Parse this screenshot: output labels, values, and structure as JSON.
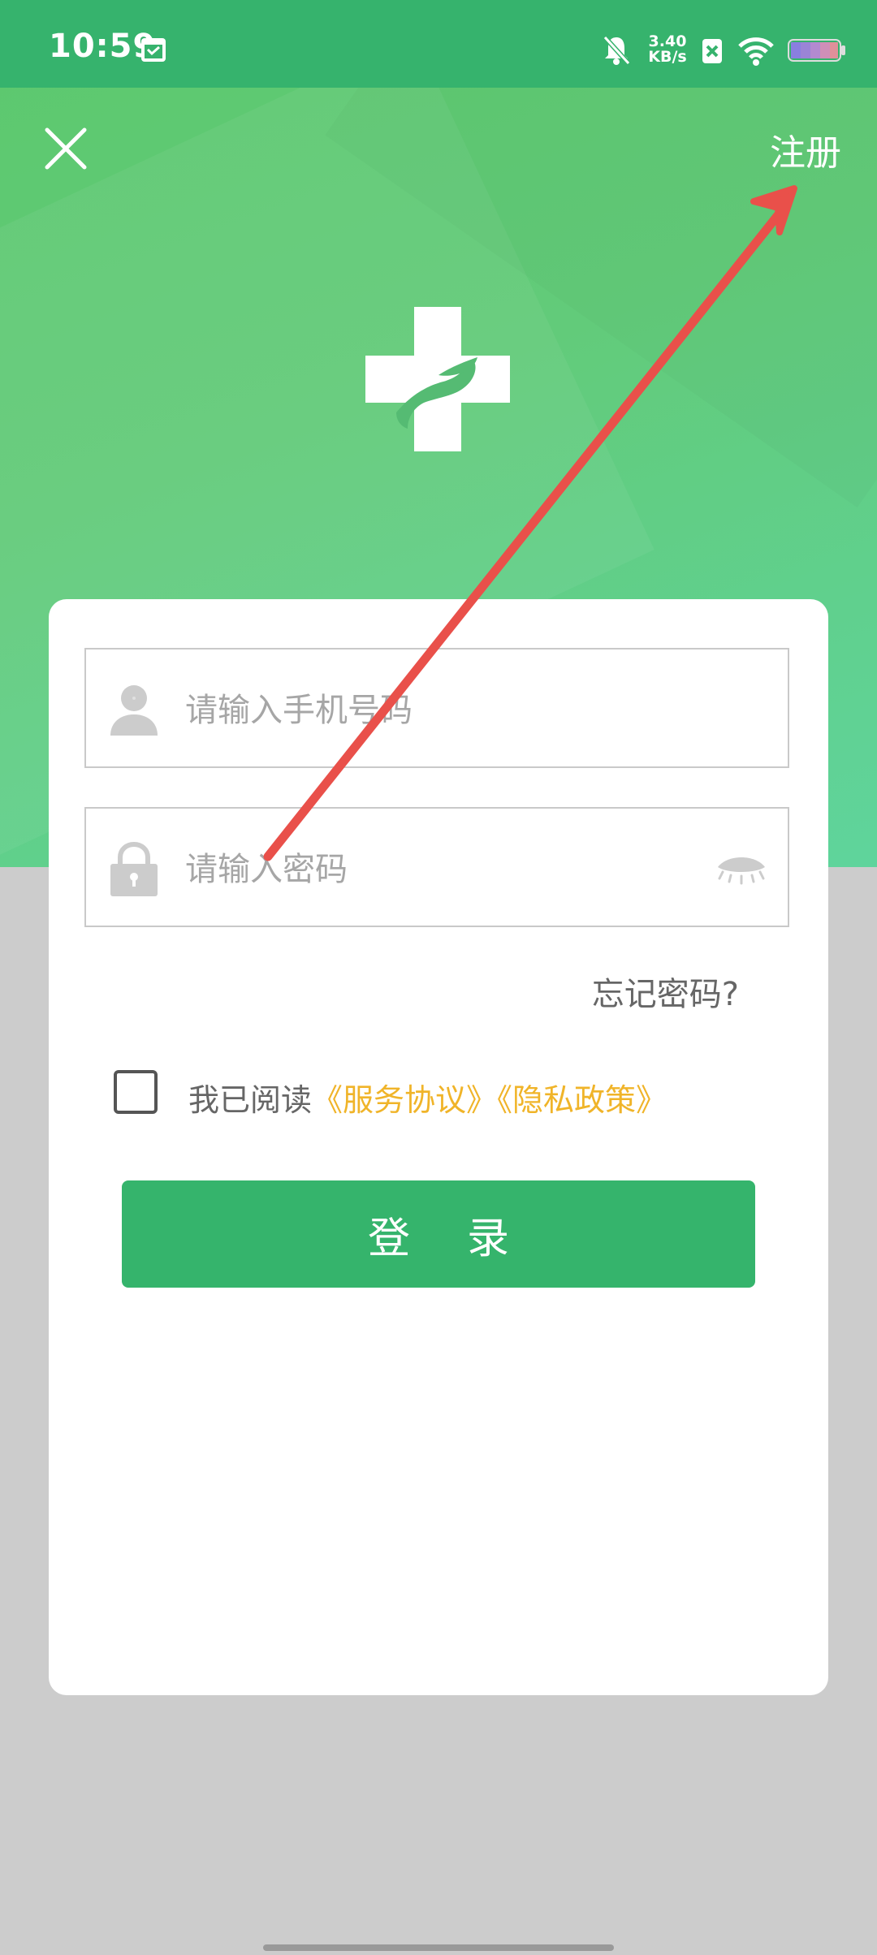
{
  "status_bar": {
    "time": "10:59",
    "net_speed_value": "3.40",
    "net_speed_unit": "KB/s"
  },
  "header": {
    "register_label": "注册"
  },
  "form": {
    "phone_placeholder": "请输入手机号码",
    "password_placeholder": "请输入密码",
    "forgot_label": "忘记密码?",
    "agree_prefix": "我已阅读",
    "service_agreement": "《服务协议》",
    "privacy_policy": "《隐私政策》",
    "login_label": "登录"
  },
  "icons": {
    "close": "close-icon",
    "logo": "medical-cross-hand-logo",
    "user": "user-icon",
    "lock": "lock-icon",
    "eye": "eye-hidden-icon"
  },
  "colors": {
    "status_bar": "#36b36d",
    "hero_green": "#5cc86d",
    "primary_button": "#35b46c",
    "link_orange": "#f0b429",
    "annotation_arrow": "#e9504a"
  }
}
